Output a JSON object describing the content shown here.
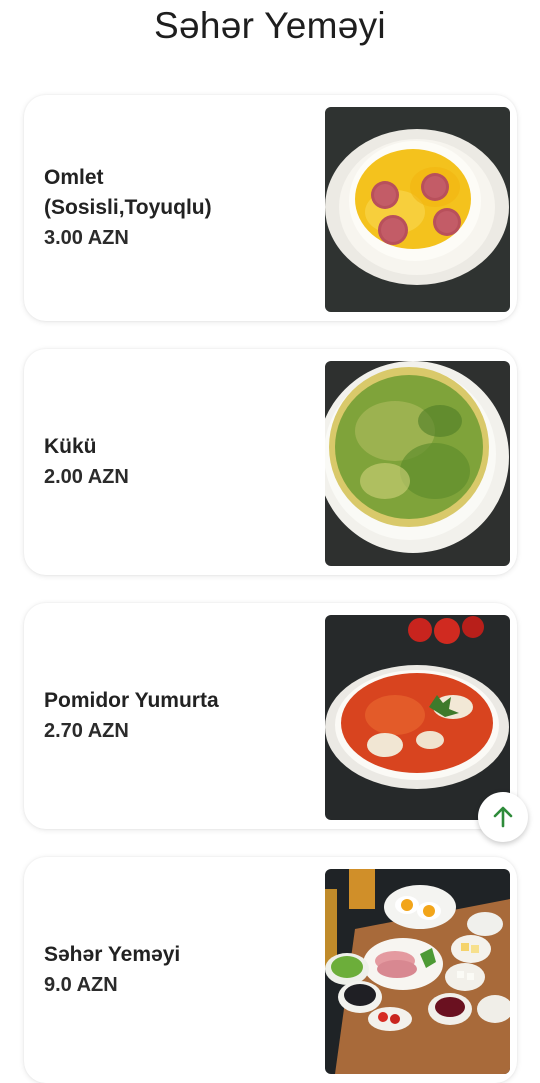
{
  "page": {
    "title": "Səhər Yeməyi"
  },
  "items": [
    {
      "name": "Omlet\n(Sosisli,Toyuqlu)",
      "price": "3.00 AZN",
      "image": "omelette-with-sausage-photo"
    },
    {
      "name": "Kükü",
      "price": "2.00 AZN",
      "image": "herb-kuku-photo"
    },
    {
      "name": "Pomidor Yumurta",
      "price": "2.70 AZN",
      "image": "tomato-egg-photo"
    },
    {
      "name": "Səhər Yeməyi",
      "price": "9.0 AZN",
      "image": "breakfast-platter-photo"
    }
  ],
  "scroll_top": {
    "icon": "arrow-up-icon",
    "color": "#2e8b3a"
  },
  "colors": {
    "background": "#ffffff",
    "text": "#1f1f1f",
    "accent": "#2e8b3a"
  }
}
